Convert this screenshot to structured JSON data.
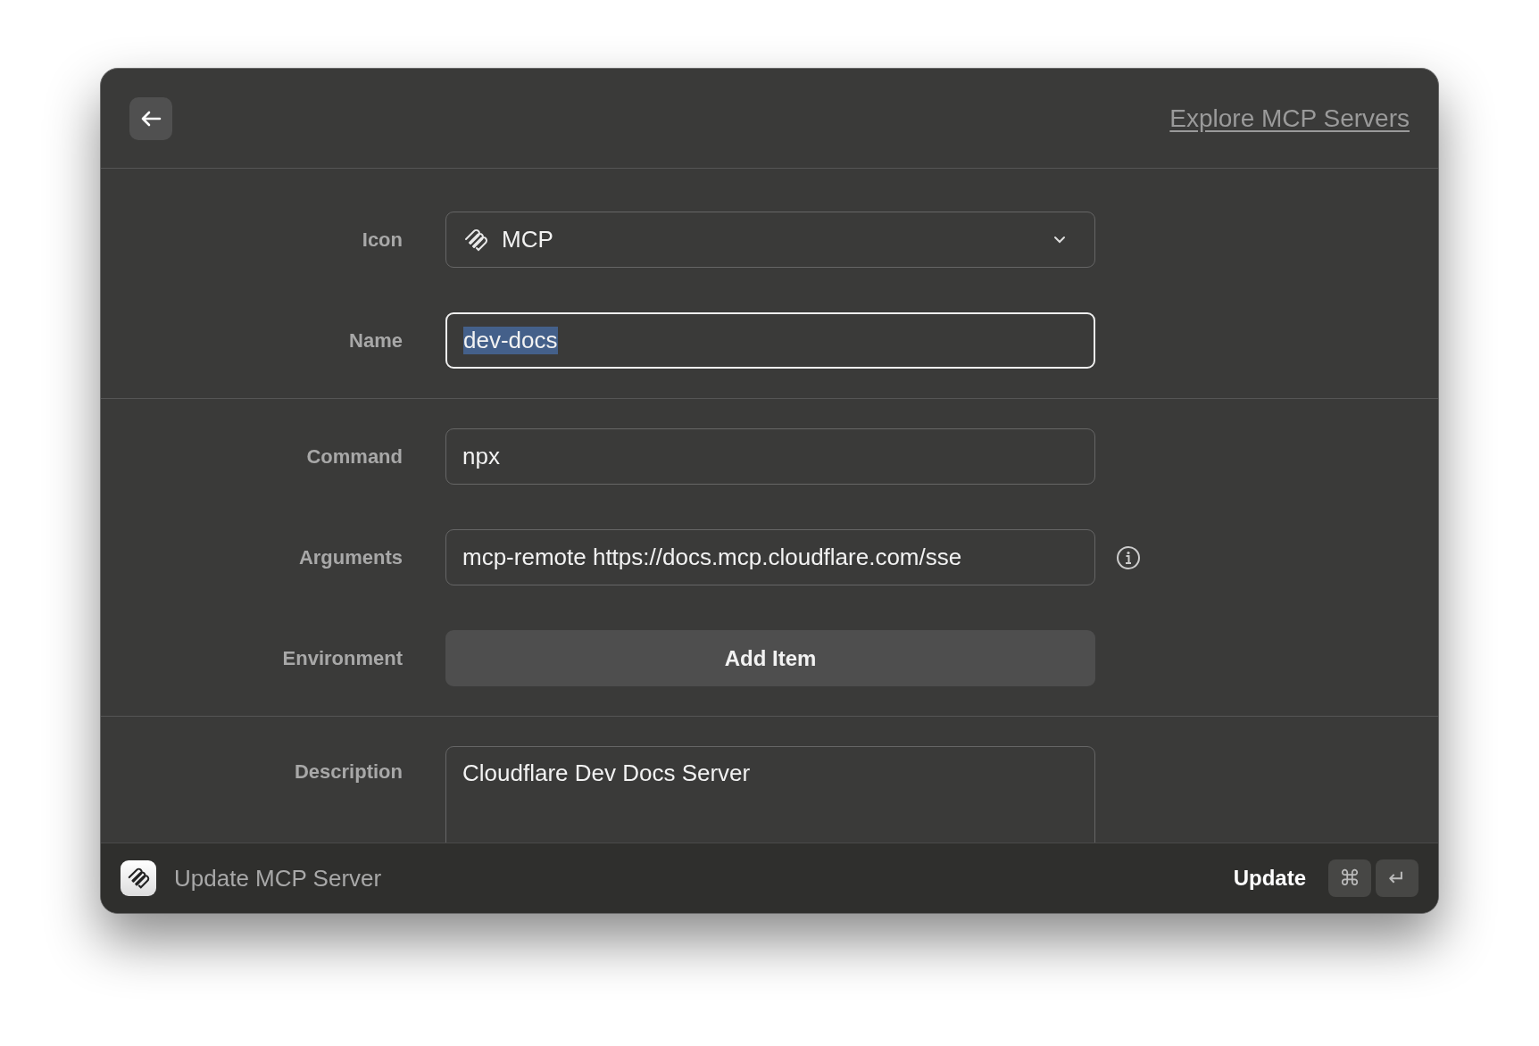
{
  "header": {
    "link": "Explore MCP Servers"
  },
  "sections": [
    {
      "rows": [
        {
          "label": "Icon",
          "kind": "select",
          "value": "MCP"
        },
        {
          "label": "Name",
          "kind": "input",
          "value": "dev-docs",
          "focused": true,
          "text_selected": true
        }
      ]
    },
    {
      "rows": [
        {
          "label": "Command",
          "kind": "input",
          "value": "npx",
          "focused": false,
          "text_selected": false
        },
        {
          "label": "Arguments",
          "kind": "input",
          "value": "mcp-remote https://docs.mcp.cloudflare.com/sse",
          "focused": false,
          "text_selected": false,
          "info": true
        },
        {
          "label": "Environment",
          "kind": "button",
          "value": "Add Item"
        }
      ]
    },
    {
      "rows": [
        {
          "label": "Description",
          "kind": "textarea",
          "value": "Cloudflare Dev Docs Server",
          "focused": false
        }
      ]
    }
  ],
  "footer": {
    "title": "Update MCP Server",
    "action": "Update",
    "keys": [
      "⌘",
      "↵"
    ]
  }
}
